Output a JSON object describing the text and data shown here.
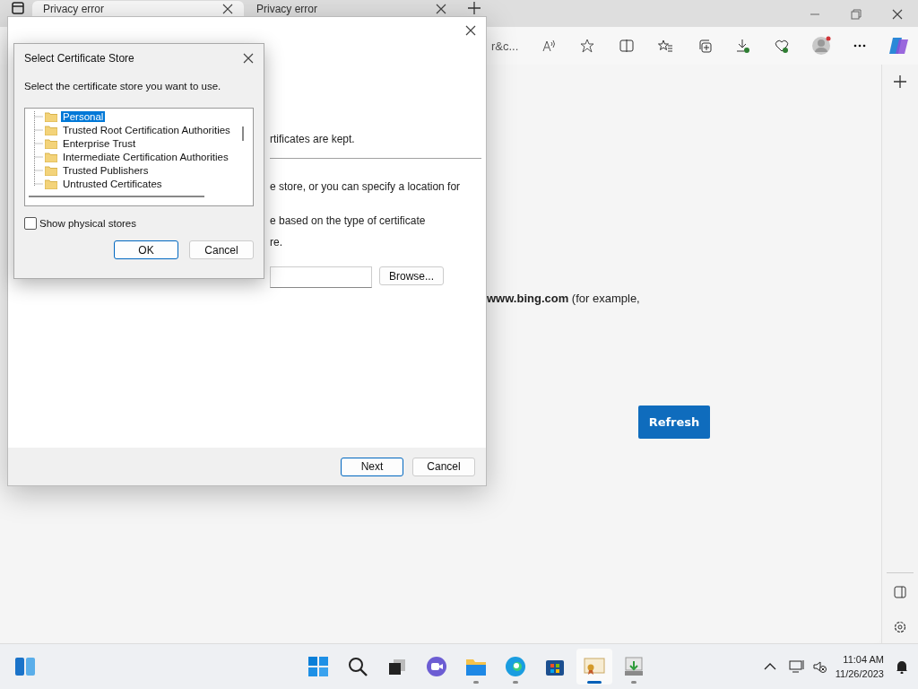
{
  "browser": {
    "tabs": [
      {
        "title": "Privacy error",
        "selected": true
      },
      {
        "title": "Privacy error",
        "selected": false
      }
    ],
    "address_fragment": "r&c...",
    "page": {
      "text": "**www.bing.com** (for example,",
      "button": "Refresh"
    }
  },
  "wizard": {
    "fragments": [
      "rtificates are kept.",
      "e store, or you can specify a location for",
      "e based on the type of certificate",
      "re."
    ],
    "browse": "Browse...",
    "buttons": [
      {
        "label": "Next",
        "default": true
      },
      {
        "label": "Cancel",
        "default": false
      }
    ]
  },
  "dialog": {
    "title": "Select Certificate Store",
    "prompt": "Select the certificate store you want to use.",
    "stores": [
      {
        "label": "Personal",
        "selected": true
      },
      {
        "label": "Trusted Root Certification Authorities",
        "selected": false
      },
      {
        "label": "Enterprise Trust",
        "selected": false
      },
      {
        "label": "Intermediate Certification Authorities",
        "selected": false
      },
      {
        "label": "Trusted Publishers",
        "selected": false
      },
      {
        "label": "Untrusted Certificates",
        "selected": false
      }
    ],
    "show_physical": {
      "label": "Show physical stores",
      "checked": false
    },
    "buttons": [
      {
        "label": "OK",
        "default": true
      },
      {
        "label": "Cancel",
        "default": false
      }
    ]
  },
  "taskbar": {
    "apps": [
      {
        "kind": "start",
        "running": false,
        "active": false
      },
      {
        "kind": "search",
        "running": false,
        "active": false
      },
      {
        "kind": "taskview",
        "running": false,
        "active": false
      },
      {
        "kind": "chat",
        "running": false,
        "active": false
      },
      {
        "kind": "explorer",
        "running": true,
        "active": false
      },
      {
        "kind": "edge",
        "running": true,
        "active": false
      },
      {
        "kind": "store",
        "running": false,
        "active": false
      },
      {
        "kind": "certificate",
        "running": true,
        "active": true
      },
      {
        "kind": "installer",
        "running": true,
        "active": false
      }
    ],
    "time": "11:04 AM",
    "date": "11/26/2023"
  }
}
